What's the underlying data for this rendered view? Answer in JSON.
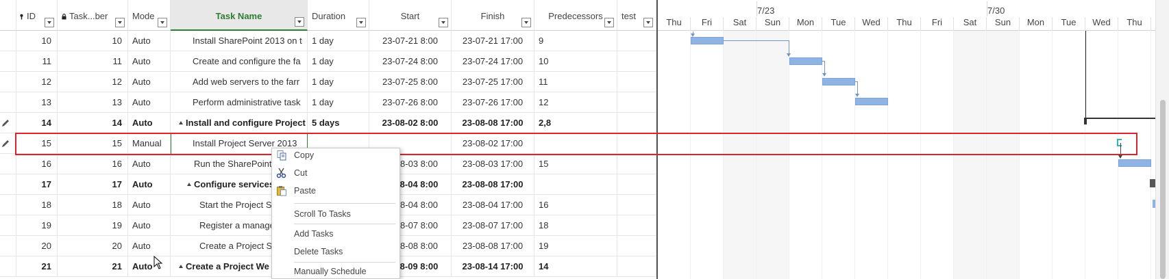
{
  "columns": {
    "id": "ID",
    "task_number": "Task...ber",
    "mode": "Mode",
    "task_name": "Task Name",
    "duration": "Duration",
    "start": "Start",
    "finish": "Finish",
    "predecessors": "Predecessors",
    "test": "test"
  },
  "rows": [
    {
      "id": "10",
      "num": "10",
      "mode": "Auto",
      "name": "Install SharePoint 2013 on t",
      "duration": "1 day",
      "start": "23-07-21 8:00",
      "finish": "23-07-21 17:00",
      "pred": "9",
      "bold": false
    },
    {
      "id": "11",
      "num": "11",
      "mode": "Auto",
      "name": "Create and configure the fa",
      "duration": "1 day",
      "start": "23-07-24 8:00",
      "finish": "23-07-24 17:00",
      "pred": "10",
      "bold": false
    },
    {
      "id": "12",
      "num": "12",
      "mode": "Auto",
      "name": "Add web servers to the farr",
      "duration": "1 day",
      "start": "23-07-25 8:00",
      "finish": "23-07-25 17:00",
      "pred": "11",
      "bold": false
    },
    {
      "id": "13",
      "num": "13",
      "mode": "Auto",
      "name": "Perform administrative task",
      "duration": "1 day",
      "start": "23-07-26 8:00",
      "finish": "23-07-26 17:00",
      "pred": "12",
      "bold": false
    },
    {
      "id": "14",
      "num": "14",
      "mode": "Auto",
      "name": "Install and configure Project",
      "duration": "5 days",
      "start": "23-08-02 8:00",
      "finish": "23-08-08 17:00",
      "pred": "2,8",
      "bold": true
    },
    {
      "id": "15",
      "num": "15",
      "mode": "Manual",
      "name": "Install Project Server 2013",
      "duration": "",
      "start": "",
      "finish": "23-08-02 17:00",
      "pred": "",
      "bold": false
    },
    {
      "id": "16",
      "num": "16",
      "mode": "Auto",
      "name": "Run the SharePoint",
      "duration": "",
      "start": "23-08-03 8:00",
      "finish": "23-08-03 17:00",
      "pred": "15",
      "bold": false
    },
    {
      "id": "17",
      "num": "17",
      "mode": "Auto",
      "name": "Configure services",
      "duration": "",
      "start": "23-08-04 8:00",
      "finish": "23-08-08 17:00",
      "pred": "",
      "bold": true
    },
    {
      "id": "18",
      "num": "18",
      "mode": "Auto",
      "name": "Start the Project S",
      "duration": "",
      "start": "23-08-04 8:00",
      "finish": "23-08-04 17:00",
      "pred": "16",
      "bold": false
    },
    {
      "id": "19",
      "num": "19",
      "mode": "Auto",
      "name": "Register a manage",
      "duration": "",
      "start": "23-08-07 8:00",
      "finish": "23-08-07 17:00",
      "pred": "18",
      "bold": false
    },
    {
      "id": "20",
      "num": "20",
      "mode": "Auto",
      "name": "Create a Project S",
      "duration": "",
      "start": "23-08-08 8:00",
      "finish": "23-08-08 17:00",
      "pred": "19",
      "bold": false
    },
    {
      "id": "21",
      "num": "21",
      "mode": "Auto",
      "name": "Create a Project We",
      "duration": "",
      "start": "23-08-09 8:00",
      "finish": "23-08-14 17:00",
      "pred": "14",
      "bold": true
    }
  ],
  "gantt": {
    "weeks": [
      "7/23",
      "7/30"
    ],
    "days": [
      "Thu",
      "Fri",
      "Sat",
      "Sun",
      "Mon",
      "Tue",
      "Wed",
      "Thu",
      "Fri",
      "Sat",
      "Sun",
      "Mon",
      "Tue",
      "Wed",
      "Thu"
    ]
  },
  "context_menu": {
    "copy": "Copy",
    "cut": "Cut",
    "paste": "Paste",
    "scroll_to_tasks": "Scroll To Tasks",
    "add_tasks": "Add Tasks",
    "delete_tasks": "Delete Tasks",
    "manually_schedule": "Manually Schedule"
  },
  "colors": {
    "accent": "#2e7d32",
    "selection": "#d9232d",
    "bar": "#8fb4e3"
  }
}
